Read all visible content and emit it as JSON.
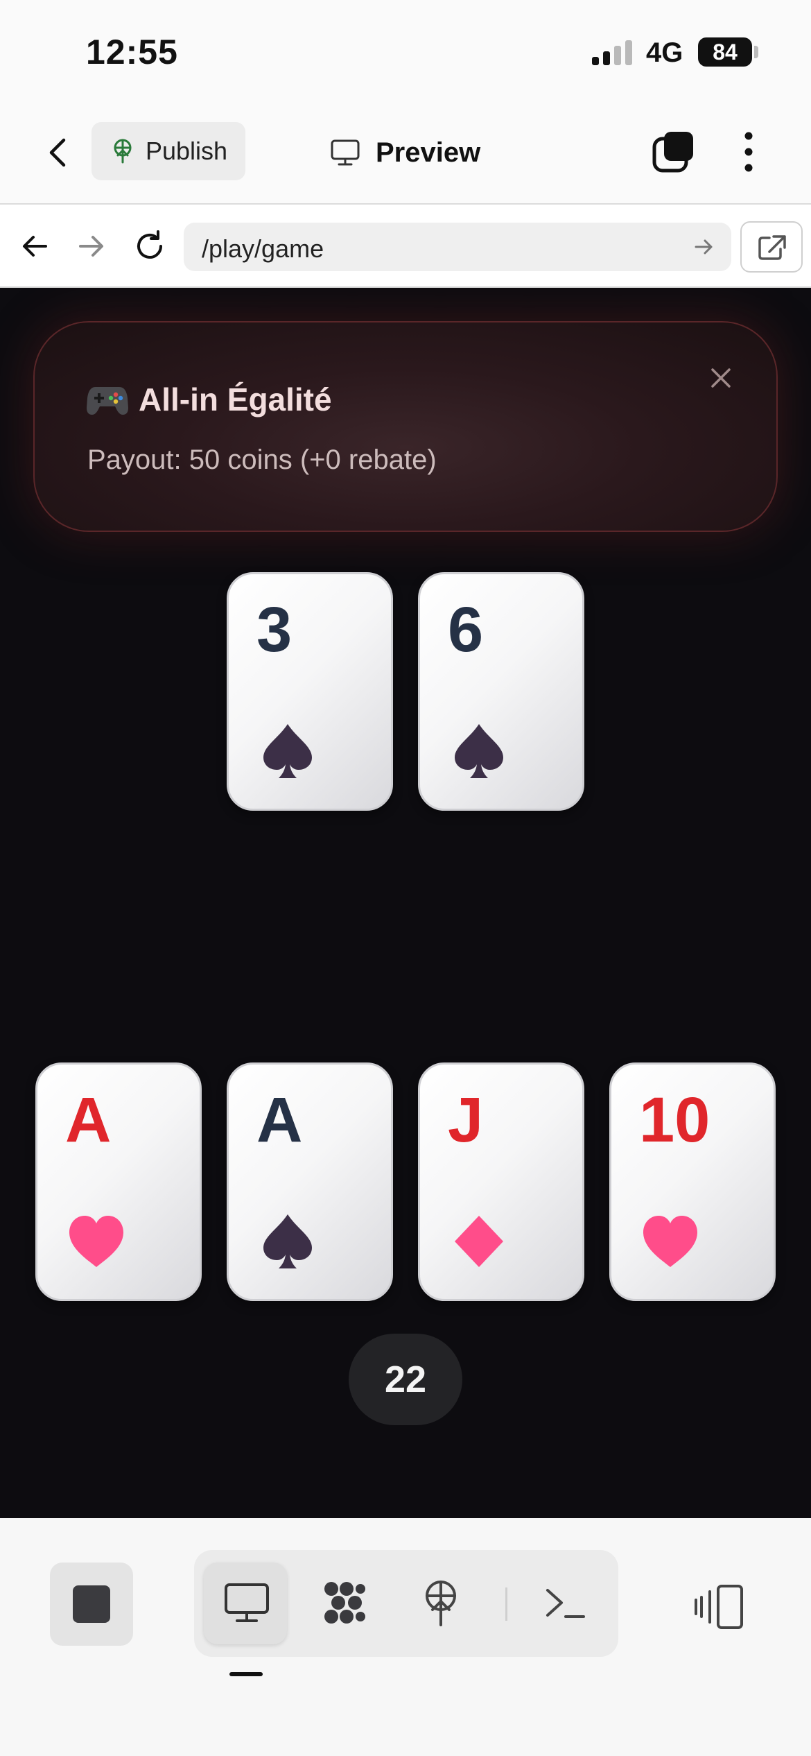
{
  "status_bar": {
    "time": "12:55",
    "network": "4G",
    "battery": "84"
  },
  "header": {
    "publish_label": "Publish",
    "preview_label": "Preview"
  },
  "browser": {
    "url": "/play/game"
  },
  "banner": {
    "title": "All-in Égalité",
    "subtitle": "Payout: 50 coins (+0 rebate)"
  },
  "dealer_cards": [
    {
      "rank": "3",
      "suit": "spade",
      "color": "black"
    },
    {
      "rank": "6",
      "suit": "spade",
      "color": "black"
    }
  ],
  "player_cards": [
    {
      "rank": "A",
      "suit": "heart",
      "color": "red"
    },
    {
      "rank": "A",
      "suit": "spade",
      "color": "black"
    },
    {
      "rank": "J",
      "suit": "diamond",
      "color": "red"
    },
    {
      "rank": "10",
      "suit": "heart",
      "color": "red"
    }
  ],
  "hand_total": "22",
  "toolbar": {
    "items": [
      "preview-icon",
      "components-icon",
      "publish-icon",
      "terminal-icon"
    ],
    "active": "preview-icon"
  },
  "colors": {
    "table": "#0d0c10",
    "red_rank": "#e0262b",
    "black_rank": "#253146",
    "heart": "#ff4d8a",
    "spade": "#3c2f47"
  }
}
